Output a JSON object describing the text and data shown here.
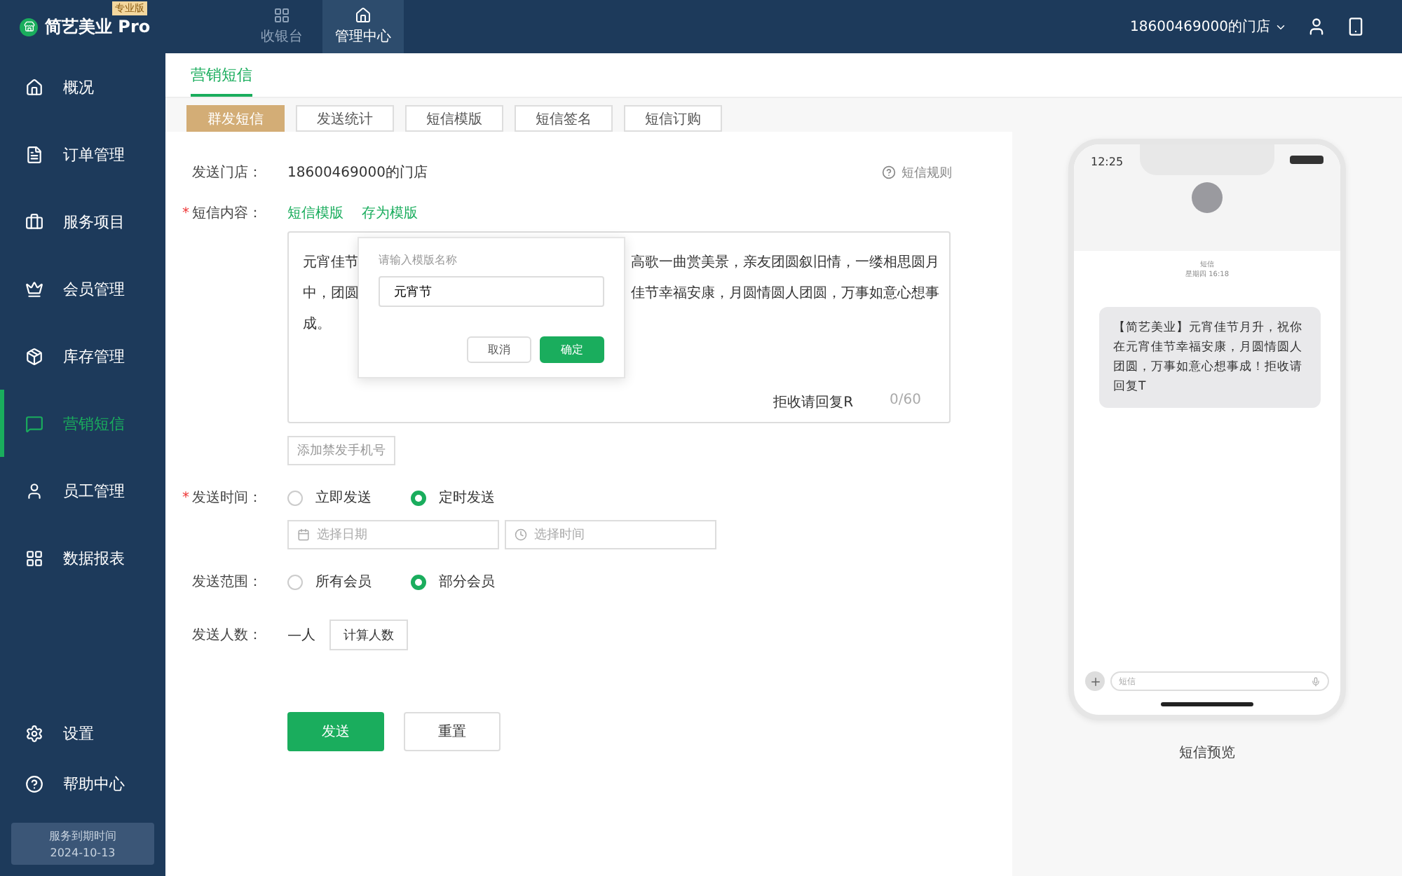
{
  "app": {
    "logo": "简艺美业 Pro",
    "edition": "专业版"
  },
  "top_nav": [
    {
      "label": "收银台",
      "selected": false
    },
    {
      "label": "管理中心",
      "selected": true
    }
  ],
  "store_switcher": "18600469000的门店",
  "sidebar": {
    "items": [
      {
        "label": "概况",
        "selected": false
      },
      {
        "label": "订单管理",
        "selected": false
      },
      {
        "label": "服务项目",
        "selected": false
      },
      {
        "label": "会员管理",
        "selected": false
      },
      {
        "label": "库存管理",
        "selected": false
      },
      {
        "label": "营销短信",
        "selected": true
      },
      {
        "label": "员工管理",
        "selected": false
      },
      {
        "label": "数据报表",
        "selected": false
      }
    ],
    "footer_items": [
      "设置",
      "帮助中心"
    ],
    "expiry": {
      "label": "服务到期时间",
      "date": "2024-10-13"
    }
  },
  "page_title": "营销短信",
  "tabs": [
    {
      "label": "群发短信",
      "selected": true
    },
    {
      "label": "发送统计",
      "selected": false
    },
    {
      "label": "短信模版",
      "selected": false
    },
    {
      "label": "短信签名",
      "selected": false
    },
    {
      "label": "短信订购",
      "selected": false
    }
  ],
  "form": {
    "store": {
      "label": "发送门店：",
      "value": "18600469000的门店"
    },
    "rules_link": "短信规则",
    "content": {
      "label": "短信内容：",
      "required_mark": "*",
      "links": [
        "短信模版",
        "存为模版"
      ],
      "lines": [
        {
          "left": "元宵佳节",
          "right": "高歌一曲赏美景，亲友团圆叙旧情，一缕相思圆月"
        },
        {
          "left": "中，团圆",
          "right": "佳节幸福安康，月圆情圆人团圆，万事如意心想事"
        },
        {
          "left": "成。"
        }
      ],
      "suffix": "拒收请回复R",
      "counter": "0/60"
    },
    "add_phone": "添加禁发手机号",
    "send_time": {
      "label": "发送时间：",
      "required_mark": "*",
      "options": [
        {
          "label": "立即发送",
          "selected": false
        },
        {
          "label": "定时发送",
          "selected": true
        }
      ],
      "date_placeholder": "选择日期",
      "time_placeholder": "选择时间"
    },
    "scope": {
      "label": "发送范围：",
      "options": [
        {
          "label": "所有会员",
          "selected": false
        },
        {
          "label": "部分会员",
          "selected": true
        }
      ]
    },
    "count": {
      "label": "发送人数：",
      "value": "—人",
      "button": "计算人数"
    },
    "submit": "发送",
    "reset": "重置"
  },
  "popover": {
    "label": "请输入模版名称",
    "value": "元宵节",
    "cancel": "取消",
    "confirm": "确定"
  },
  "preview": {
    "time": "12:25",
    "contact": "短信",
    "date": "星期四 16:18",
    "message": "【简艺美业】元宵佳节月升，祝你在元宵佳节幸福安康，月圆情圆人团圆，万事如意心想事成！拒收请回复T",
    "input_placeholder": "短信",
    "caption": "短信预览"
  }
}
